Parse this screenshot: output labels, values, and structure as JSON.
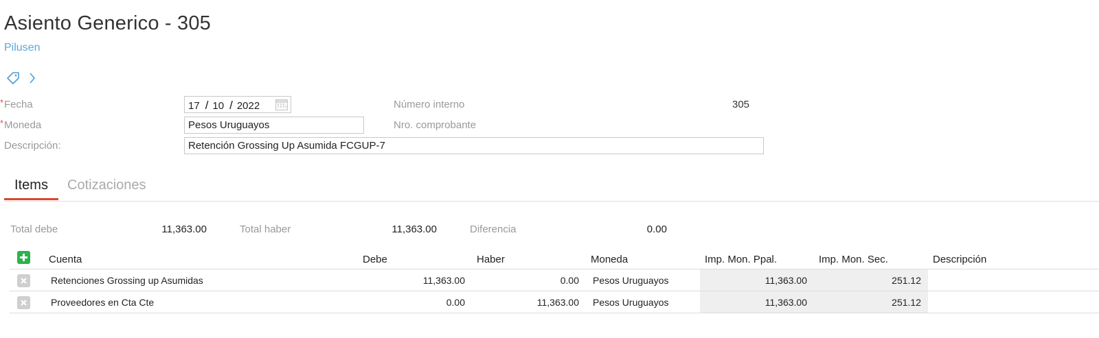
{
  "header": {
    "title": "Asiento Generico - 305",
    "subtitle": "Pilusen"
  },
  "form": {
    "fecha": {
      "label": "Fecha",
      "day": "17",
      "month": "10",
      "year": "2022",
      "sep": "/"
    },
    "moneda": {
      "label": "Moneda",
      "value": "Pesos Uruguayos"
    },
    "descripcion": {
      "label": "Descripción:",
      "value": "Retención Grossing Up Asumida FCGUP-7"
    },
    "numero_interno": {
      "label": "Número interno",
      "value": "305"
    },
    "nro_comprobante": {
      "label": "Nro. comprobante",
      "value": ""
    },
    "required_mark": "*"
  },
  "tabs": [
    {
      "label": "Items",
      "active": true
    },
    {
      "label": "Cotizaciones",
      "active": false
    }
  ],
  "totals": {
    "total_debe_label": "Total debe",
    "total_debe": "11,363.00",
    "total_haber_label": "Total haber",
    "total_haber": "11,363.00",
    "diferencia_label": "Diferencia",
    "diferencia": "0.00"
  },
  "table": {
    "columns": [
      "Cuenta",
      "Debe",
      "Haber",
      "Moneda",
      "Imp. Mon. Ppal.",
      "Imp. Mon. Sec.",
      "Descripción"
    ],
    "rows": [
      {
        "cuenta": "Retenciones Grossing up Asumidas",
        "debe": "11,363.00",
        "haber": "0.00",
        "moneda": "Pesos Uruguayos",
        "imp_ppal": "11,363.00",
        "imp_sec": "251.12",
        "descripcion": ""
      },
      {
        "cuenta": "Proveedores en Cta Cte",
        "debe": "0.00",
        "haber": "11,363.00",
        "moneda": "Pesos Uruguayos",
        "imp_ppal": "11,363.00",
        "imp_sec": "251.12",
        "descripcion": ""
      }
    ]
  },
  "colors": {
    "accent_link": "#5ba7d9",
    "tab_underline": "#d9462f",
    "add_button": "#2db34a",
    "required": "#d9534f"
  },
  "icons": [
    "tag-icon",
    "chevron-right-icon",
    "calendar-icon",
    "add-row-icon",
    "delete-row-icon"
  ]
}
